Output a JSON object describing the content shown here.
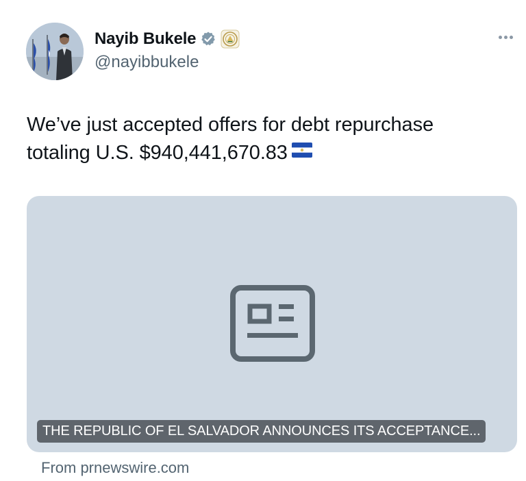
{
  "user": {
    "display_name": "Nayib Bukele",
    "handle": "@nayibbukele"
  },
  "tweet": {
    "text_line1": "We’ve just accepted offers for debt repurchase",
    "text_line2": "totaling U.S. $940,441,670.83"
  },
  "card": {
    "title": "THE REPUBLIC OF EL SALVADOR ANNOUNCES ITS ACCEPTANCE...",
    "source": "From prnewswire.com"
  },
  "colors": {
    "verified_badge": "#829aab",
    "card_background": "#cfd9e3",
    "secondary_text": "#536471",
    "news_icon": "#5b6770"
  },
  "icons": [
    "verified-icon",
    "government-seal-icon",
    "more-icon",
    "el-salvador-flag-icon",
    "news-article-icon"
  ]
}
